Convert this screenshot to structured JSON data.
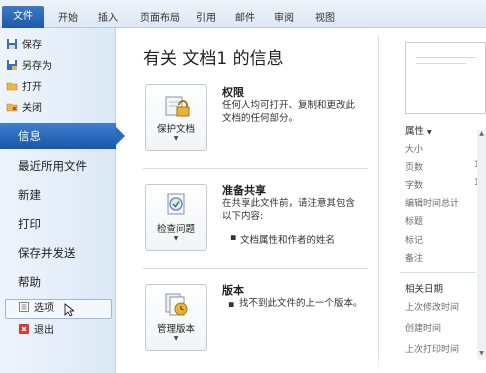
{
  "tabs": {
    "file": "文件",
    "items": [
      "开始",
      "插入",
      "页面布局",
      "引用",
      "邮件",
      "审阅",
      "视图"
    ]
  },
  "sidebar": {
    "commands": [
      {
        "label": "保存",
        "icon": "save-icon"
      },
      {
        "label": "另存为",
        "icon": "save-as-icon"
      },
      {
        "label": "打开",
        "icon": "open-folder-icon"
      },
      {
        "label": "关闭",
        "icon": "close-doc-icon"
      }
    ],
    "pages": [
      {
        "label": "信息",
        "selected": true
      },
      {
        "label": "最近所用文件"
      },
      {
        "label": "新建"
      },
      {
        "label": "打印"
      },
      {
        "label": "保存并发送"
      },
      {
        "label": "帮助"
      }
    ],
    "options": {
      "label": "选项",
      "icon": "options-icon"
    },
    "exit": {
      "label": "退出",
      "icon": "exit-icon"
    }
  },
  "main": {
    "title": "有关 文档1 的信息",
    "sections": [
      {
        "button": "保护文档",
        "heading": "权限",
        "text": "任何人均可打开、复制和更改此文档的任何部分。"
      },
      {
        "button": "检查问题",
        "heading": "准备共享",
        "text": "在共享此文件前，请注意其包含以下内容:",
        "bullet": "文档属性和作者的姓名"
      },
      {
        "button": "管理版本",
        "heading": "版本",
        "bullet": "找不到此文件的上一个版本。"
      }
    ]
  },
  "properties": {
    "heading": "属性",
    "items": [
      "大小",
      "页数",
      "字数",
      "编辑时间总计",
      "标题",
      "标记",
      "备注"
    ],
    "values": [
      "1",
      "1"
    ],
    "dates_heading": "相关日期",
    "dates": [
      "上次修改时间",
      "创建时间",
      "上次打印时间"
    ]
  },
  "colors": {
    "accent": "#2b67ba",
    "ribbon": "#dfe8f5",
    "sidebar": "#e4edf8"
  }
}
